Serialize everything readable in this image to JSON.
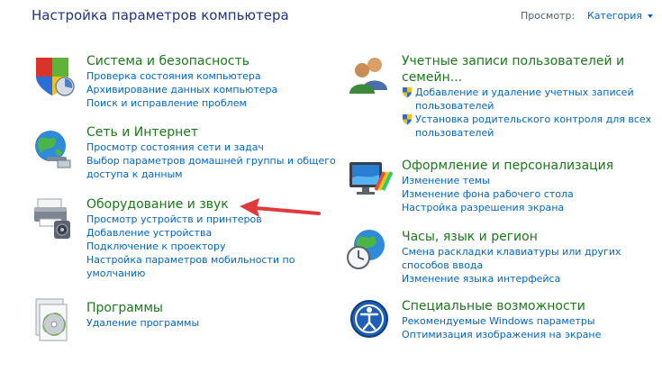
{
  "header": {
    "title": "Настройка параметров компьютера",
    "view_label": "Просмотр:",
    "view_value": "Категория"
  },
  "left_categories": [
    {
      "title": "Система и безопасность",
      "icon": "security-shield-icon",
      "links": [
        "Проверка состояния компьютера",
        "Архивирование данных компьютера",
        "Поиск и исправление проблем"
      ]
    },
    {
      "title": "Сеть и Интернет",
      "icon": "network-globe-icon",
      "links": [
        "Просмотр состояния сети и задач",
        "Выбор параметров домашней группы и общего",
        "доступа к данным"
      ]
    },
    {
      "title": "Оборудование и звук",
      "icon": "printer-icon",
      "links": [
        "Просмотр устройств и принтеров",
        "Добавление устройства",
        "Подключение к проектору",
        "Настройка параметров мобильности по",
        "умолчанию"
      ]
    },
    {
      "title": "Программы",
      "icon": "programs-disc-icon",
      "links": [
        "Удаление программы"
      ]
    }
  ],
  "right_categories": [
    {
      "title_line1": "Учетные записи пользователей и",
      "title_line2": "семейн...",
      "icon": "users-icon",
      "links": [
        "Добавление и удаление учетных записей",
        "пользователей",
        "Установка родительского контроля для всех",
        "пользователей"
      ]
    },
    {
      "title": "Оформление и персонализация",
      "icon": "appearance-monitor-icon",
      "links": [
        "Изменение темы",
        "Изменение фона рабочего стола",
        "Настройка разрешения экрана"
      ]
    },
    {
      "title": "Часы, язык и регион",
      "icon": "clock-globe-icon",
      "links": [
        "Смена раскладки клавиатуры или других",
        "способов ввода",
        "Изменение языка интерфейса"
      ]
    },
    {
      "title": "Специальные возможности",
      "icon": "accessibility-icon",
      "links": [
        "Рекомендуемые Windows параметры",
        "Оптимизация изображения на экране"
      ]
    }
  ],
  "colors": {
    "header": "#1e3287",
    "category_title": "#1a7a1a",
    "link": "#0066cc",
    "arrow": "#e03a3a"
  }
}
